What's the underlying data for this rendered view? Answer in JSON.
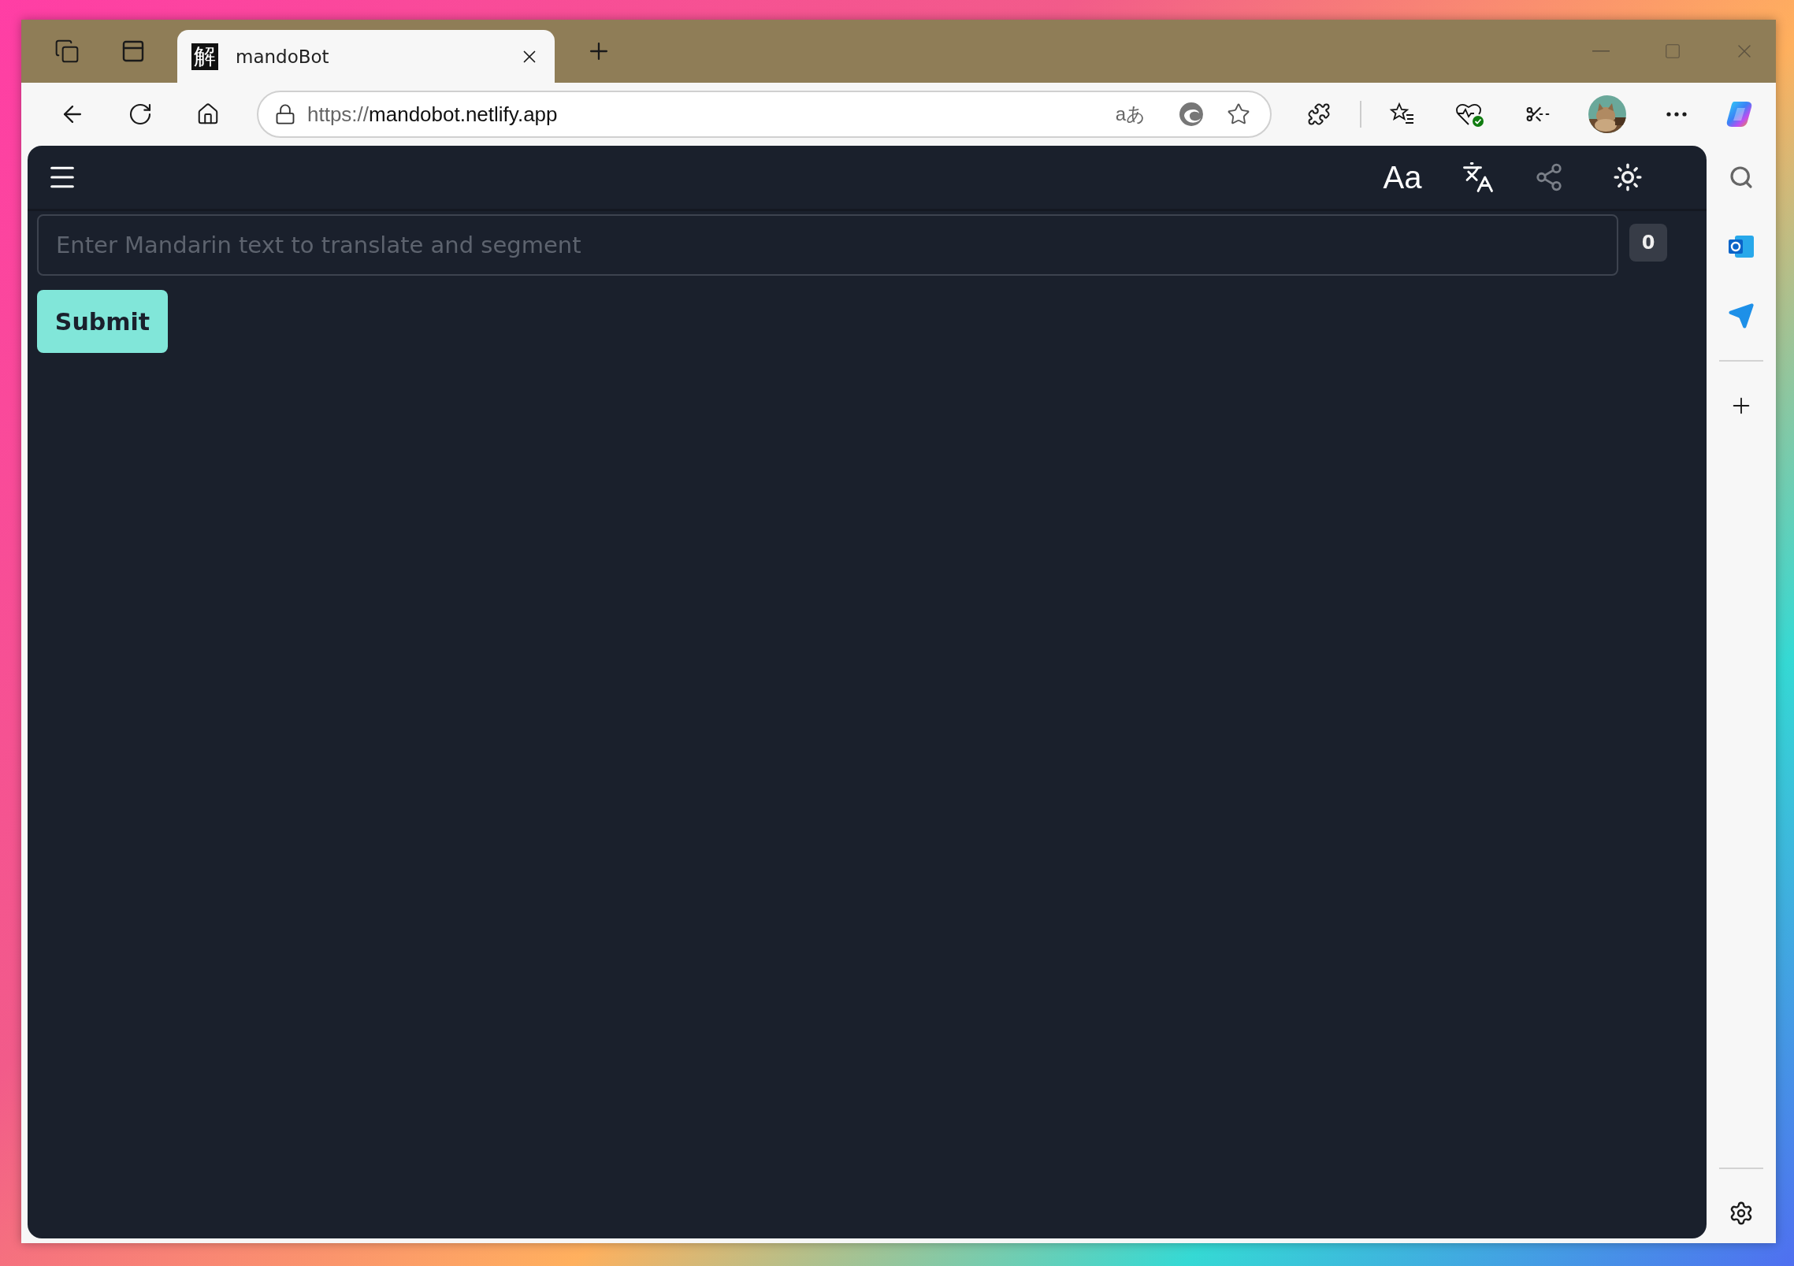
{
  "browser": {
    "tabs": [
      {
        "favicon": "解",
        "title": "mandoBot",
        "selected": true
      }
    ],
    "address_bar": {
      "scheme": "https://",
      "host": "mandobot.netlify.app"
    },
    "read_aloud_label": "aあ"
  },
  "app": {
    "header": {
      "font_button": "Aa"
    },
    "input": {
      "placeholder": "Enter Mandarin text to translate and segment"
    },
    "char_count": "0",
    "submit": "Submit"
  }
}
